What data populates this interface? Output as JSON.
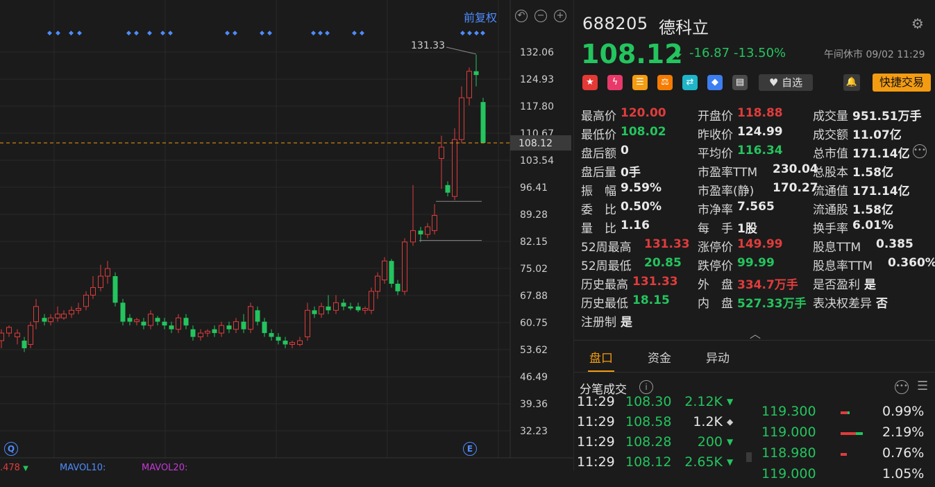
{
  "chart": {
    "restore_label": "前复权",
    "price_ticks": [
      "132.06",
      "124.93",
      "117.80",
      "110.67",
      "103.54",
      "96.41",
      "89.28",
      "82.15",
      "75.02",
      "67.88",
      "60.75",
      "53.62",
      "46.49",
      "39.36",
      "32.23"
    ],
    "current_price_label": "108.12",
    "peak_label": "131.33",
    "q_button": "Q",
    "e_button": "E",
    "ma_legend": [
      {
        "label": ".478",
        "color": "#e03c3c"
      },
      {
        "label": "MAVOL10:",
        "color": "#4e8cff"
      },
      {
        "label": "MAVOL20:",
        "color": "#c43ad6"
      }
    ],
    "colors": {
      "up": "#e03c3c",
      "down": "#24c45e",
      "marker": "#4e8cff",
      "price_line": "#f39c12"
    }
  },
  "header": {
    "code": "688205",
    "name": "德科立",
    "price": "108.12",
    "change": "-16.87",
    "change_pct": "-13.50%",
    "status": "午间休市 09/02 11:29",
    "fav_label": "自选",
    "quick_trade_label": "快捷交易"
  },
  "icons": [
    {
      "name": "china-flag-icon",
      "glyph": "★",
      "bg": "#e53935"
    },
    {
      "name": "lightning-icon",
      "glyph": "ϟ",
      "bg": "#e83a6a"
    },
    {
      "name": "database-icon",
      "glyph": "☰",
      "bg": "#f39c12"
    },
    {
      "name": "scale-icon",
      "glyph": "⚖",
      "bg": "#f57c00"
    },
    {
      "name": "shuffle-icon",
      "glyph": "⇄",
      "bg": "#1fb5c9"
    },
    {
      "name": "tag-icon",
      "glyph": "◆",
      "bg": "#3d7ef0"
    },
    {
      "name": "note-icon",
      "glyph": "▤",
      "bg": "#4a4a4a"
    }
  ],
  "stats": [
    [
      {
        "label": "最高价",
        "value": "120.00",
        "color": "#e03c3c"
      },
      {
        "label": "开盘价",
        "value": "118.88",
        "color": "#e03c3c"
      },
      {
        "label": "成交量",
        "value": "951.51万手",
        "color": "#e8e8e8"
      }
    ],
    [
      {
        "label": "最低价",
        "value": "108.02",
        "color": "#24c45e"
      },
      {
        "label": "昨收价",
        "value": "124.99",
        "color": "#e8e8e8"
      },
      {
        "label": "成交额",
        "value": "11.07亿",
        "color": "#e8e8e8"
      }
    ],
    [
      {
        "label": "盘后额",
        "value": "0",
        "color": "#e8e8e8"
      },
      {
        "label": "平均价",
        "value": "116.34",
        "color": "#24c45e"
      },
      {
        "label": "总市值",
        "value": "171.14亿",
        "color": "#e8e8e8"
      }
    ],
    [
      {
        "label": "盘后量",
        "value": "0手",
        "color": "#e8e8e8"
      },
      {
        "label": "市盈率TTM",
        "value": "230.04",
        "color": "#e8e8e8"
      },
      {
        "label": "总股本",
        "value": "1.58亿",
        "color": "#e8e8e8"
      }
    ],
    [
      {
        "label": "振　幅",
        "value": "9.59%",
        "color": "#e8e8e8"
      },
      {
        "label": "市盈率(静)",
        "value": "170.27",
        "color": "#e8e8e8"
      },
      {
        "label": "流通值",
        "value": "171.14亿",
        "color": "#e8e8e8"
      }
    ],
    [
      {
        "label": "委　比",
        "value": "0.50%",
        "color": "#e8e8e8"
      },
      {
        "label": "市净率",
        "value": "7.565",
        "color": "#e8e8e8"
      },
      {
        "label": "流通股",
        "value": "1.58亿",
        "color": "#e8e8e8"
      }
    ],
    [
      {
        "label": "量　比",
        "value": "1.16",
        "color": "#e8e8e8"
      },
      {
        "label": "每　手",
        "value": "1股",
        "color": "#e8e8e8"
      },
      {
        "label": "换手率",
        "value": "6.01%",
        "color": "#e8e8e8"
      }
    ],
    [
      {
        "label": "52周最高",
        "value": "131.33",
        "color": "#e03c3c"
      },
      {
        "label": "涨停价",
        "value": "149.99",
        "color": "#e03c3c"
      },
      {
        "label": "股息TTM",
        "value": "0.385",
        "color": "#e8e8e8"
      }
    ],
    [
      {
        "label": "52周最低",
        "value": "20.85",
        "color": "#24c45e"
      },
      {
        "label": "跌停价",
        "value": "99.99",
        "color": "#24c45e"
      },
      {
        "label": "股息率TTM",
        "value": "0.360%",
        "color": "#e8e8e8"
      }
    ],
    [
      {
        "label": "历史最高",
        "value": "131.33",
        "color": "#e03c3c"
      },
      {
        "label": "外　盘",
        "value": "334.7万手",
        "color": "#e03c3c"
      },
      {
        "label": "是否盈利",
        "value": "是",
        "color": "#e8e8e8"
      }
    ],
    [
      {
        "label": "历史最低",
        "value": "18.15",
        "color": "#24c45e"
      },
      {
        "label": "内　盘",
        "value": "527.33万手",
        "color": "#24c45e"
      },
      {
        "label": "表决权差异",
        "value": "否",
        "color": "#e8e8e8"
      }
    ],
    [
      {
        "label": "注册制",
        "value": "是",
        "color": "#e8e8e8"
      }
    ]
  ],
  "tabs": [
    "盘口",
    "资金",
    "异动"
  ],
  "ticks_title": "分笔成交",
  "trades": [
    {
      "time": "11:29",
      "price": "108.30",
      "vol": "2.12K",
      "dir": "down"
    },
    {
      "time": "11:29",
      "price": "108.58",
      "vol": "1.2K",
      "dir": "neutral"
    },
    {
      "time": "11:29",
      "price": "108.28",
      "vol": "200",
      "dir": "down"
    },
    {
      "time": "11:29",
      "price": "108.12",
      "vol": "2.65K",
      "dir": "down"
    }
  ],
  "book": [
    {
      "price": "119.300",
      "pct": "0.99%",
      "green": 0.08,
      "red": 0.26
    },
    {
      "price": "119.000",
      "pct": "2.19%",
      "green": 0.24,
      "red": 0.54
    },
    {
      "price": "118.980",
      "pct": "0.76%",
      "green": 0.0,
      "red": 0.22
    },
    {
      "price": "119.000",
      "pct": "1.05%",
      "green": 0.0,
      "red": 0.0
    }
  ]
}
